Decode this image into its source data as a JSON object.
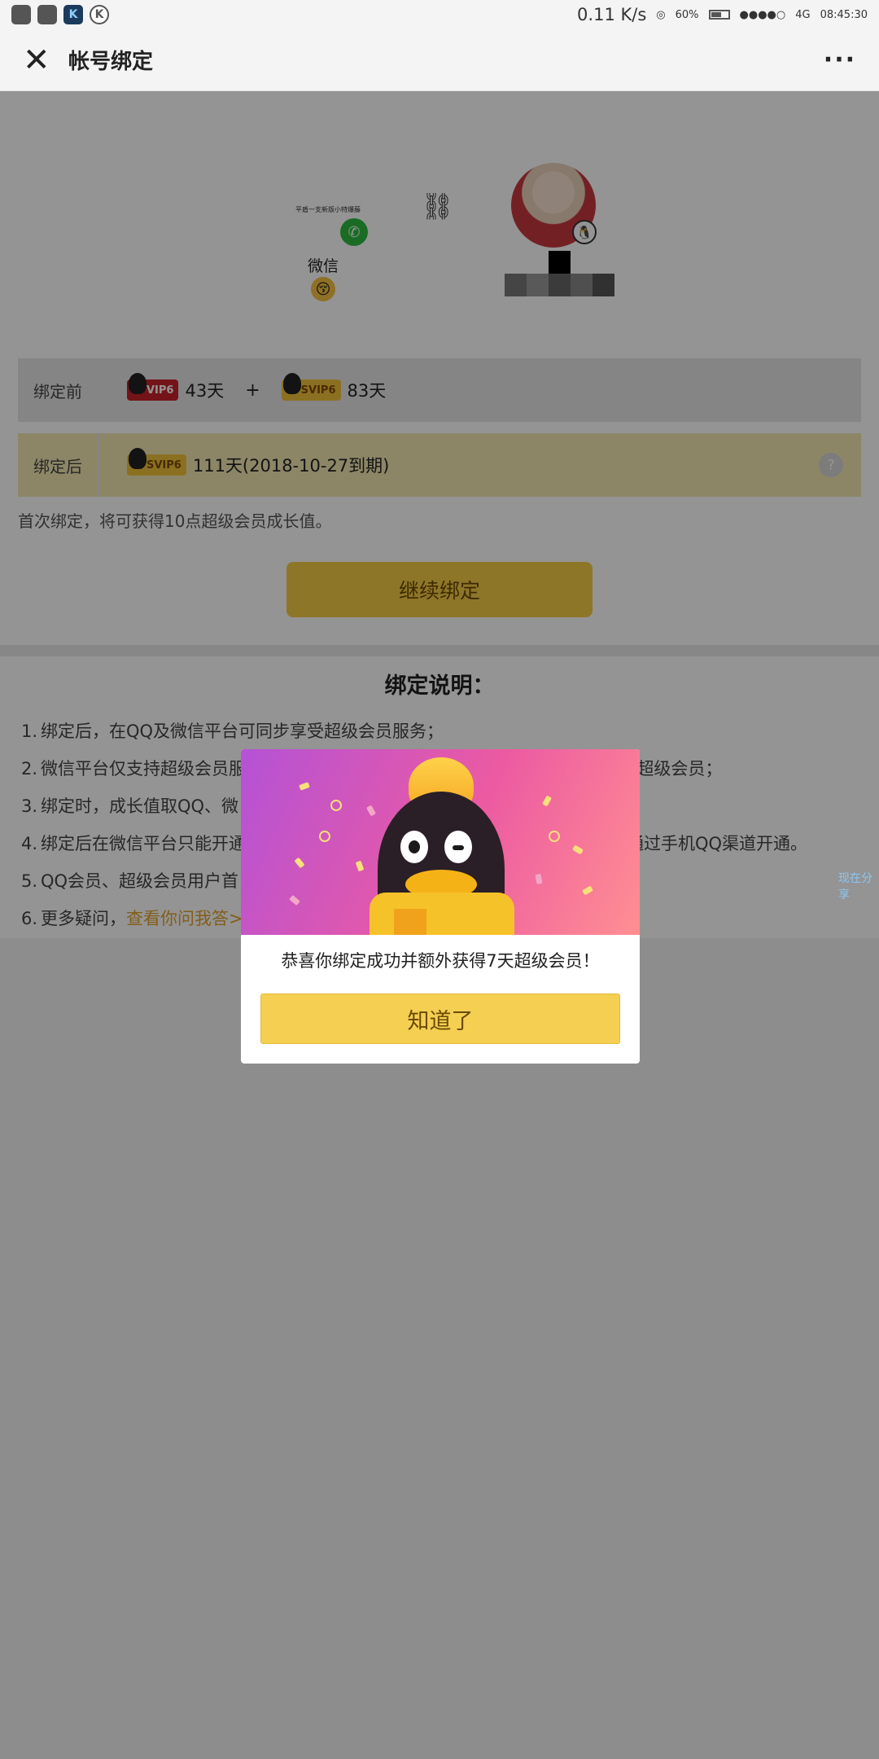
{
  "status_bar": {
    "speed": "0.11 K/s",
    "battery_percent": "60%",
    "network": "4G",
    "time": "08:45:30"
  },
  "nav": {
    "title": "帐号绑定",
    "more": "···"
  },
  "accounts": {
    "wechat_label": "微信",
    "wechat_avatar_text": "平盾一支新版小特爆藤"
  },
  "binding": {
    "before_label": "绑定前",
    "after_label": "绑定后",
    "before_vip_badge": "VIP6",
    "before_vip_days": "43天",
    "plus": "+",
    "before_svip_badge": "SVIP6",
    "before_svip_days": "83天",
    "after_svip_badge": "SVIP6",
    "after_value": "111天(2018-10-27到期)",
    "help": "?"
  },
  "note": "首次绑定，将可获得10点超级会员成长值。",
  "continue_button": "继续绑定",
  "instructions": {
    "title": "绑定说明：",
    "items": [
      {
        "num": "1.",
        "text": "绑定后，在QQ及微信平台可同步享受超级会员服务；"
      },
      {
        "num": "2.",
        "text": "微信平台仅支持超级会员服",
        "tail": "长会按照0.5倍转为超级会员；"
      },
      {
        "num": "3.",
        "text": "绑定时，成长值取QQ、微"
      },
      {
        "num": "4.",
        "text": "绑定后在微信平台只能开通",
        "tail": "在超级会员过期后通过手机QQ渠道开通。"
      },
      {
        "num": "5.",
        "text": "QQ会员、超级会员用户首"
      },
      {
        "num": "6.",
        "text": "更多疑问，",
        "link": "查看你问我答>"
      }
    ]
  },
  "side_tag": "现在分享",
  "modal": {
    "message": "恭喜你绑定成功并额外获得7天超级会员！",
    "button": "知道了"
  },
  "colors": {
    "accent_yellow": "#f4cc48",
    "vip_red": "#c9232a",
    "wechat_green": "#2dbb3e",
    "link_orange": "#e1a330"
  }
}
